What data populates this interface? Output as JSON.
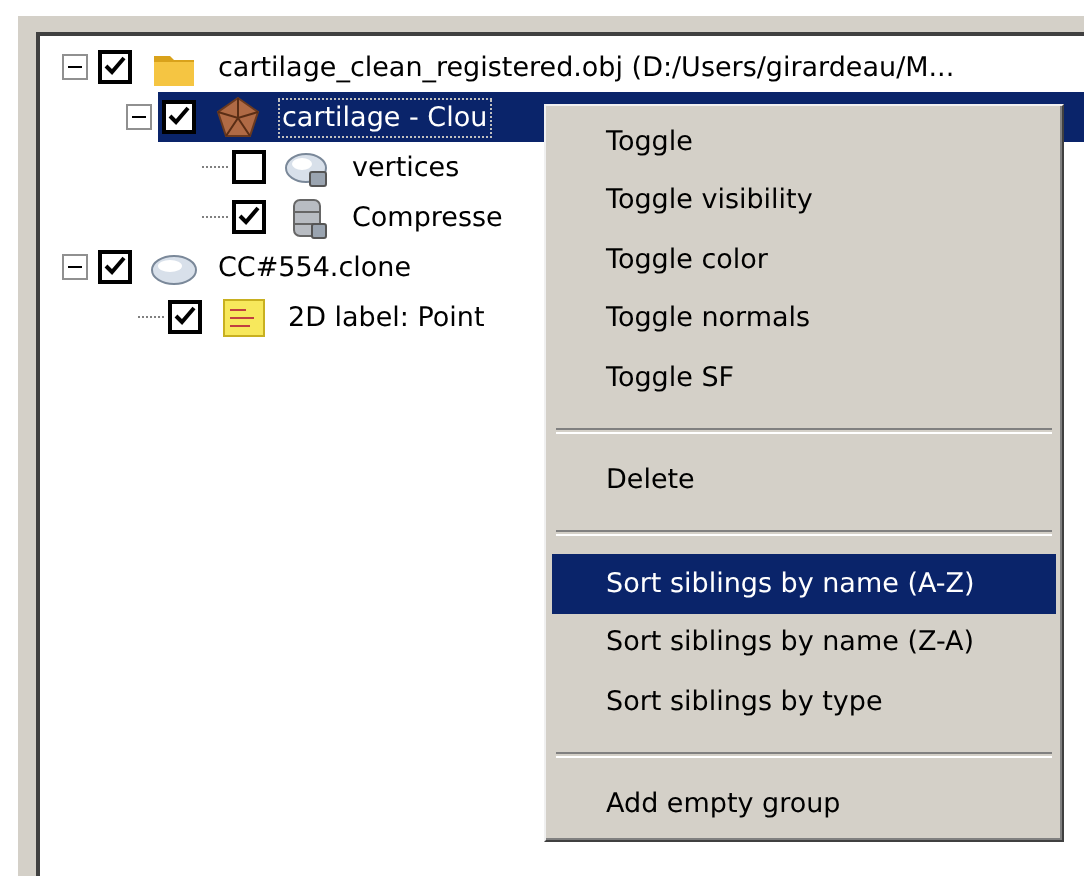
{
  "tree": {
    "items": [
      {
        "label": "cartilage_clean_registered.obj (D:/Users/girardeau/M...",
        "kind": "group",
        "checked": true,
        "selected": false,
        "expanded": true,
        "children": [
          {
            "label": "cartilage - Clou",
            "kind": "mesh",
            "checked": true,
            "selected": true,
            "expanded": true,
            "children": [
              {
                "label": "vertices",
                "kind": "vertices",
                "checked": false,
                "selected": false
              },
              {
                "label": "Compresse",
                "kind": "normals",
                "checked": true,
                "selected": false
              }
            ]
          }
        ]
      },
      {
        "label": "CC#554.clone",
        "kind": "cloud",
        "checked": true,
        "selected": false,
        "expanded": true,
        "children": [
          {
            "label": "2D label: Point",
            "kind": "label",
            "checked": true,
            "selected": false
          }
        ]
      }
    ]
  },
  "context_menu": {
    "items": [
      {
        "kind": "item",
        "label": "Toggle",
        "selected": false
      },
      {
        "kind": "item",
        "label": "Toggle visibility",
        "selected": false
      },
      {
        "kind": "item",
        "label": "Toggle color",
        "selected": false
      },
      {
        "kind": "item",
        "label": "Toggle normals",
        "selected": false
      },
      {
        "kind": "item",
        "label": "Toggle SF",
        "selected": false
      },
      {
        "kind": "separator"
      },
      {
        "kind": "item",
        "label": "Delete",
        "selected": false
      },
      {
        "kind": "separator"
      },
      {
        "kind": "item",
        "label": "Sort siblings by name (A-Z)",
        "selected": true
      },
      {
        "kind": "item",
        "label": "Sort siblings by name (Z-A)",
        "selected": false
      },
      {
        "kind": "item",
        "label": "Sort siblings by type",
        "selected": false
      },
      {
        "kind": "separator"
      },
      {
        "kind": "item",
        "label": "Add empty group",
        "selected": false
      }
    ]
  }
}
